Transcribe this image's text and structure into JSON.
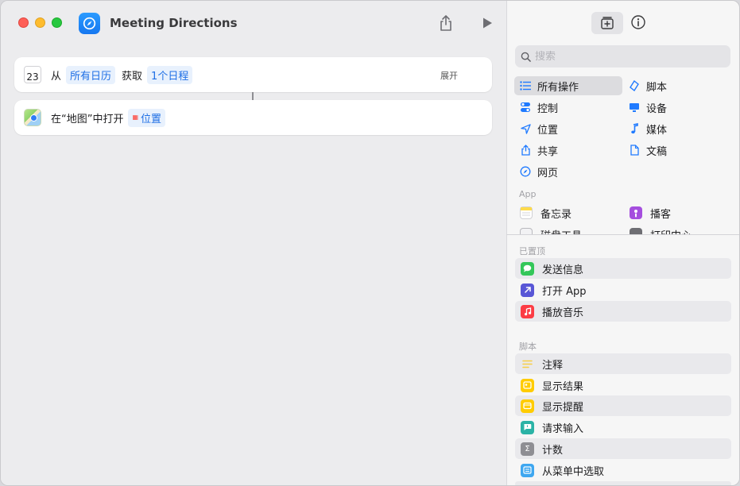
{
  "window": {
    "title": "Meeting Directions"
  },
  "editor": {
    "actions": [
      {
        "parts": {
          "from": "从",
          "source": "所有日历",
          "get": "获取",
          "count": "1个日程"
        },
        "calendar_day": "23",
        "expand_label": "展开"
      },
      {
        "parts": {
          "open_in": "在“地图”中打开",
          "param": "位置"
        }
      }
    ]
  },
  "library": {
    "search_placeholder": "搜索",
    "categories": [
      {
        "label": "所有操作",
        "icon": "list-icon",
        "selected": true
      },
      {
        "label": "脚本",
        "icon": "script-icon"
      },
      {
        "label": "控制",
        "icon": "toggle-icon"
      },
      {
        "label": "设备",
        "icon": "display-icon"
      },
      {
        "label": "位置",
        "icon": "location-arrow-icon"
      },
      {
        "label": "媒体",
        "icon": "music-note-icon"
      },
      {
        "label": "共享",
        "icon": "share-icon"
      },
      {
        "label": "文稿",
        "icon": "document-icon"
      },
      {
        "label": "网页",
        "icon": "compass-icon"
      }
    ],
    "app_section_label": "App",
    "apps": [
      {
        "label": "备忘录",
        "icon": "notes-app-icon",
        "color": "#fedb4b"
      },
      {
        "label": "播客",
        "icon": "podcasts-app-icon",
        "color": "#a54ede"
      },
      {
        "label": "磁盘工具",
        "icon": "disk-utility-app-icon",
        "color": "#8e8e93"
      },
      {
        "label": "打印中心",
        "icon": "print-center-app-icon",
        "color": "#6e6e73"
      }
    ],
    "pinned_section_label": "已置顶",
    "pinned": [
      {
        "label": "发送信息",
        "icon": "messages-icon",
        "color": "#34c759"
      },
      {
        "label": "打开 App",
        "icon": "open-app-icon",
        "color": "#5856d6"
      },
      {
        "label": "播放音乐",
        "icon": "music-icon",
        "color": "#fc3c44"
      }
    ],
    "scripting_section_label": "脚本",
    "scripting": [
      {
        "label": "注释",
        "icon": "comment-icon",
        "color": "#f7ce46"
      },
      {
        "label": "显示结果",
        "icon": "show-result-icon",
        "color": "#ffcc00"
      },
      {
        "label": "显示提醒",
        "icon": "show-alert-icon",
        "color": "#ffcc00"
      },
      {
        "label": "请求输入",
        "icon": "ask-input-icon",
        "color": "#2bb3a6"
      },
      {
        "label": "计数",
        "icon": "count-sigma-icon",
        "color": "#8e8e93"
      },
      {
        "label": "从菜单中选取",
        "icon": "choose-menu-icon",
        "color": "#3ea7f0"
      }
    ]
  }
}
